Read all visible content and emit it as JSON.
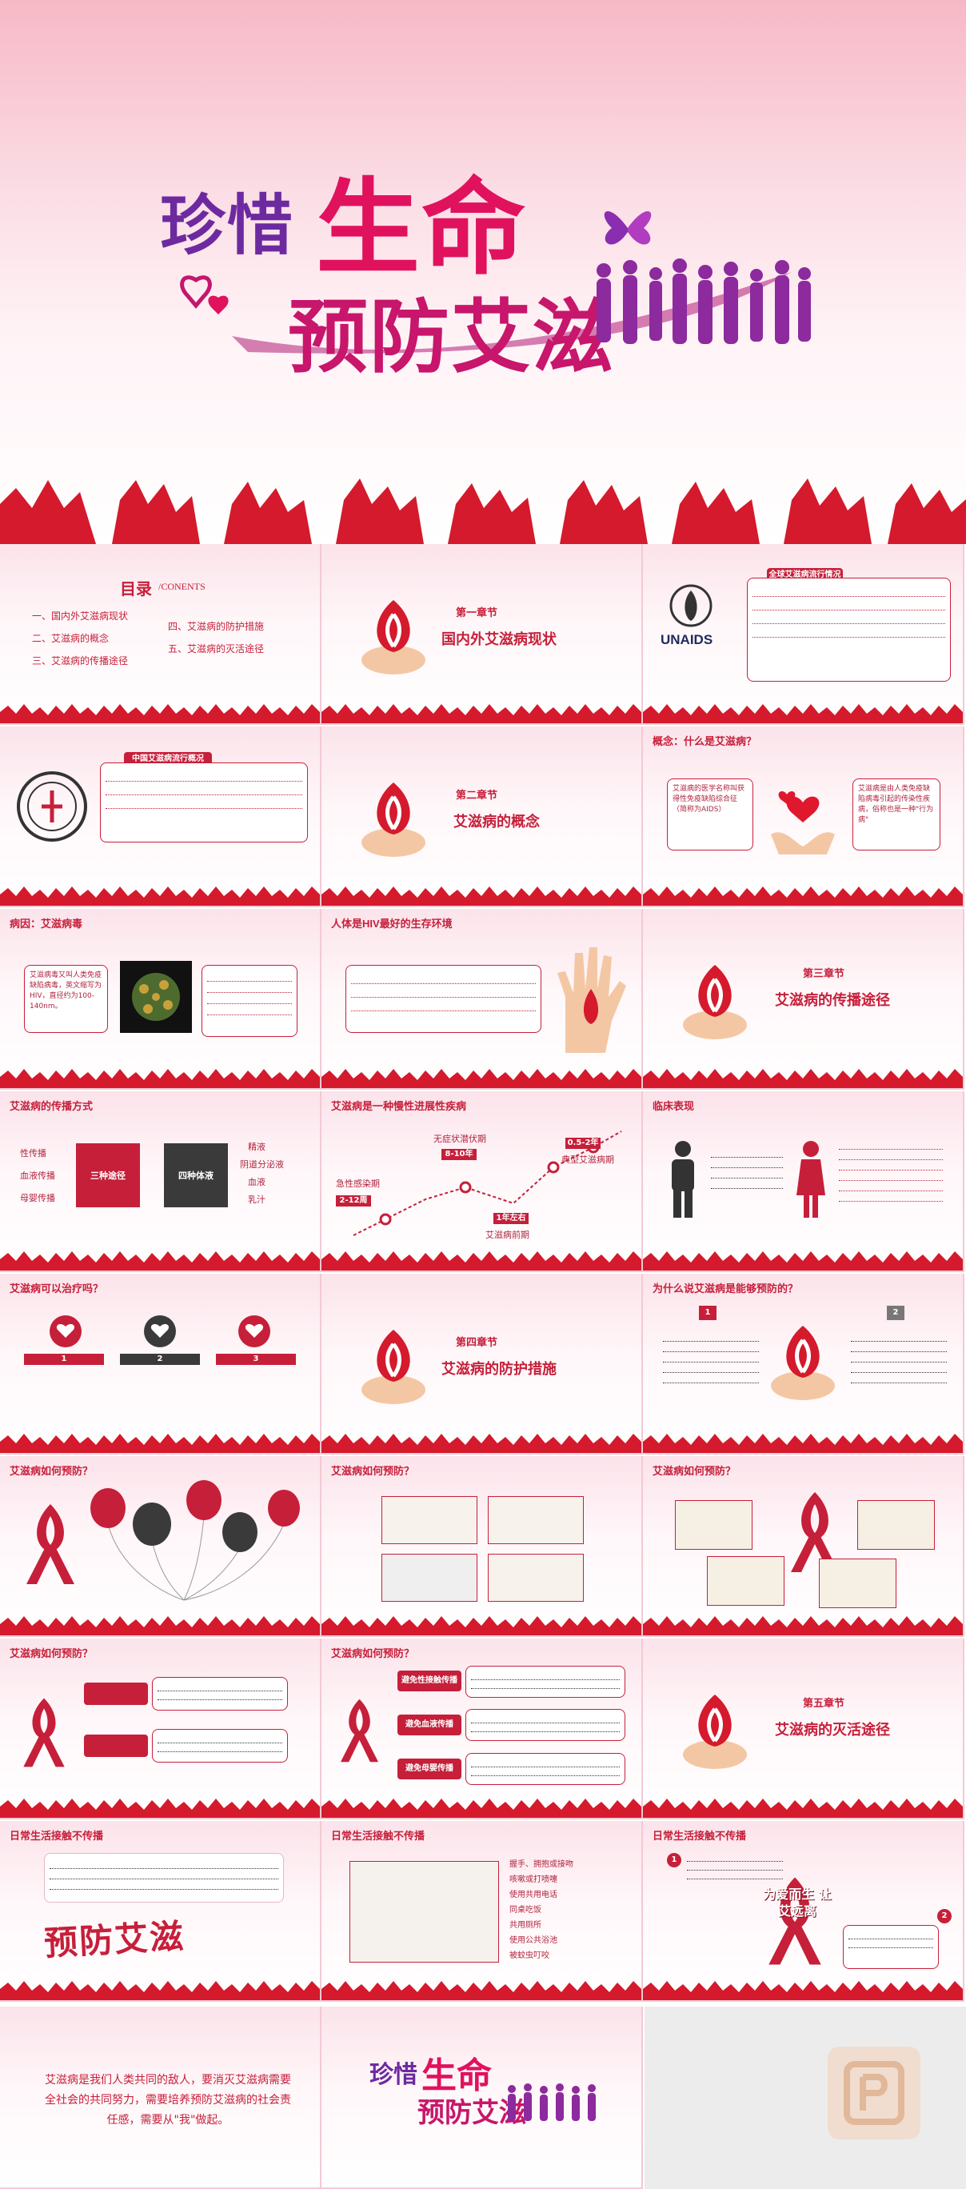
{
  "cover": {
    "title_line1_a": "珍惜",
    "title_line1_b": "生命",
    "title_line2": "预防艾滋"
  },
  "slides": {
    "toc": {
      "heading": "目录",
      "heading_en": "/CONENTS",
      "items": [
        "一、国内外艾滋病现状",
        "二、艾滋病的概念",
        "三、艾滋病的传播途径",
        "四、艾滋病的防护措施",
        "五、艾滋病的灭活途径"
      ]
    },
    "ch1": {
      "label": "第一章节",
      "title": "国内外艾滋病现状"
    },
    "unaids": {
      "box_title": "全球艾滋病流行情况",
      "logo_text": "UNAIDS"
    },
    "china": {
      "box_title": "中国艾滋病流行概况"
    },
    "ch2": {
      "label": "第二章节",
      "title": "艾滋病的概念"
    },
    "concept": {
      "header": "概念：什么是艾滋病？",
      "left": "艾滋病的医学名称叫获得性免疫缺陷综合征（简称为AIDS）",
      "right": "艾滋病是由人类免疫缺陷病毒引起的传染性疾病，俗称也是一种\"行为病\""
    },
    "virus": {
      "header": "病因：艾滋病毒",
      "left": "艾滋病毒又叫人类免疫缺陷病毒，英文缩写为HIV，直径约为100-140nm。"
    },
    "env": {
      "header": "人体是HIV最好的生存环境"
    },
    "ch3": {
      "label": "第三章节",
      "title": "艾滋病的传播途径"
    },
    "transmit": {
      "header": "艾滋病的传播方式",
      "left": [
        "性传播",
        "血液传播",
        "母婴传播"
      ],
      "red_box": "三种途径",
      "dark_box": "四种体液",
      "right": [
        "精液",
        "阴道分泌液",
        "血液",
        "乳汁"
      ]
    },
    "chronic": {
      "header": "艾滋病是一种慢性进展性疾病",
      "labels": [
        "急性感染期",
        "无症状潜伏期",
        "艾滋病前期",
        "典型艾滋病期"
      ],
      "periods": [
        "2-12周",
        "8-10年",
        "1年左右",
        "0.5-2年"
      ]
    },
    "clinic": {
      "header": "临床表现"
    },
    "cure": {
      "header": "艾滋病可以治疗吗？",
      "nums": [
        "1",
        "2",
        "3"
      ]
    },
    "ch4": {
      "label": "第四章节",
      "title": "艾滋病的防护措施"
    },
    "prevent_why": {
      "header": "为什么说艾滋病是能够预防的？",
      "nums": [
        "1",
        "2"
      ]
    },
    "howprev1": {
      "header": "艾滋病如何预防？"
    },
    "howprev2": {
      "header": "艾滋病如何预防？"
    },
    "howprev3": {
      "header": "艾滋病如何预防？"
    },
    "howprev4": {
      "header": "艾滋病如何预防？"
    },
    "howprev5": {
      "header": "艾滋病如何预防？",
      "bars": [
        "避免性接触传播",
        "避免血液传播",
        "避免母婴传播"
      ]
    },
    "ch5": {
      "label": "第五章节",
      "title": "艾滋病的灭活途径"
    },
    "daily1": {
      "header": "日常生活接触不传播",
      "stamp": "预防艾滋"
    },
    "daily2": {
      "header": "日常生活接触不传播",
      "list": [
        "握手、拥抱或接吻",
        "咳嗽或打喷嚏",
        "使用共用电话",
        "同桌吃饭",
        "共用厕所",
        "使用公共浴池",
        "被蚊虫叮咬"
      ]
    },
    "daily3": {
      "header": "日常生活接触不传播",
      "logo": "为爱而生 让艾远离"
    },
    "end": {
      "text": "艾滋病是我们人类共同的敌人，要消灭艾滋病需要全社会的共同努力，需要培养预防艾滋病的社会责任感，需要从\"我\"做起。",
      "mini_title_a": "珍惜",
      "mini_title_b": "生命",
      "mini_title_c": "预防艾滋"
    }
  }
}
